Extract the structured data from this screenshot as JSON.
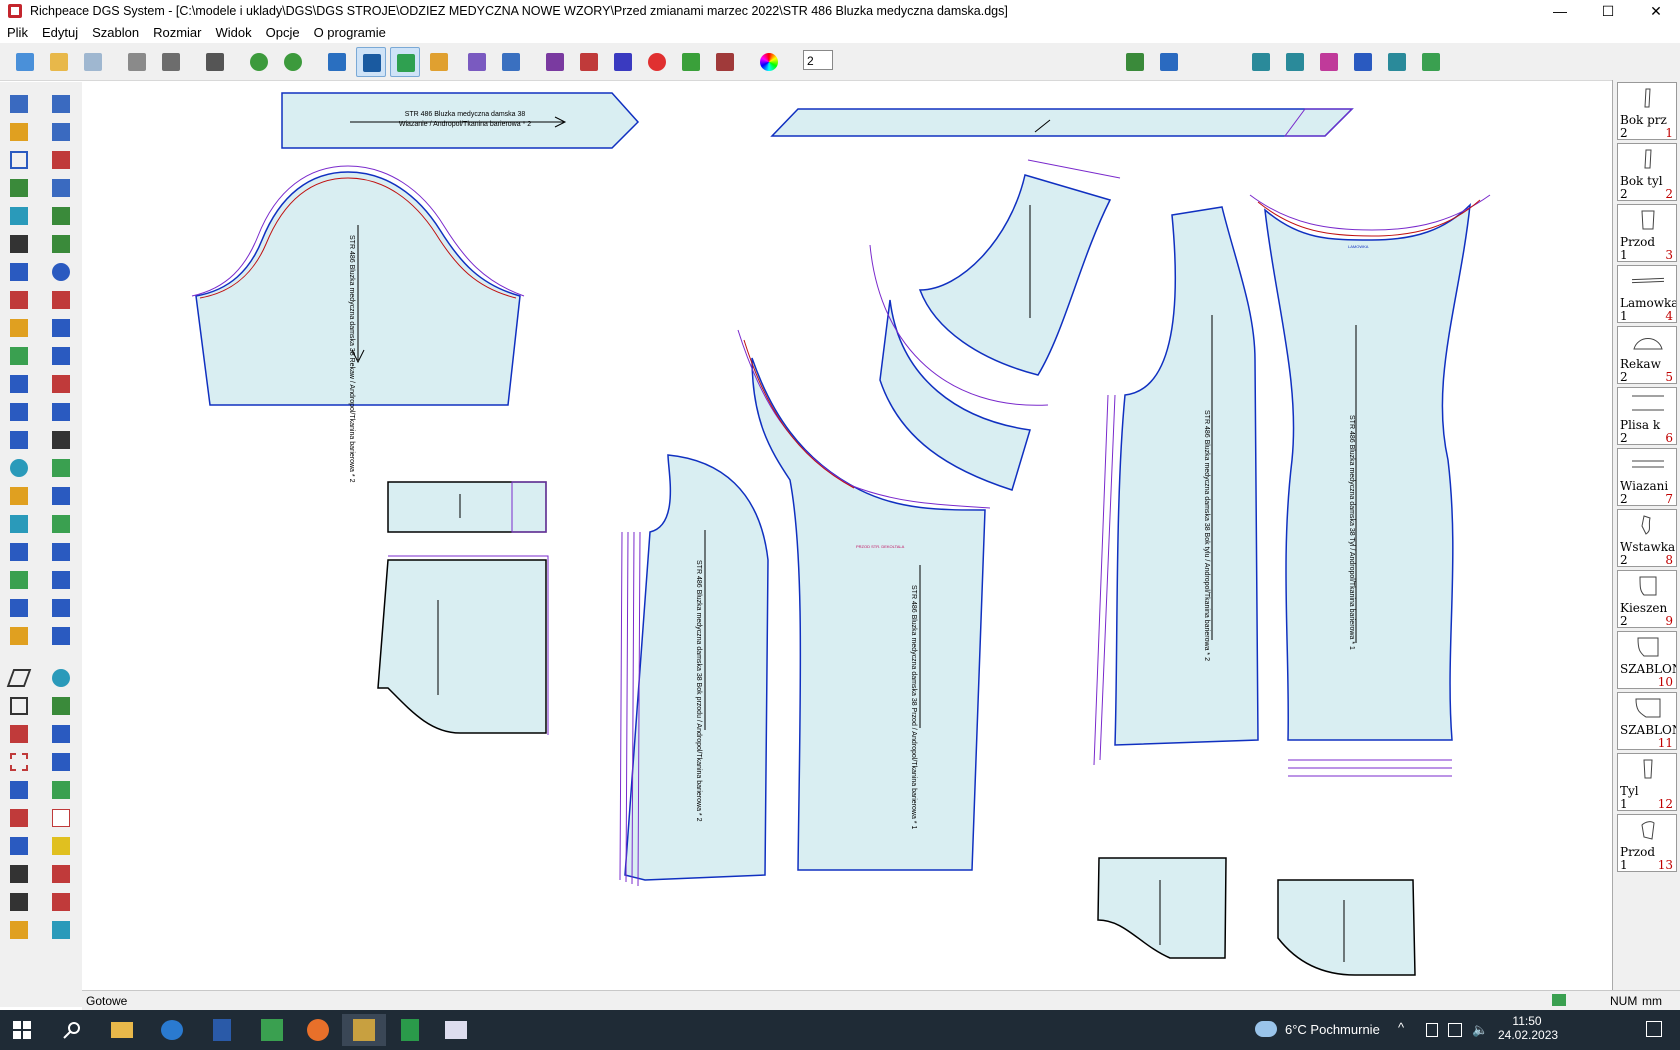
{
  "window": {
    "title": "Richpeace DGS System - [C:\\modele i uklady\\DGS\\DGS STROJE\\ODZIEZ MEDYCZNA NOWE WZORY\\Przed zmianami marzec 2022\\STR 486 Bluzka medyczna damska.dgs]",
    "minimize": "—",
    "maximize": "☐",
    "close": "✕"
  },
  "menu": [
    "Plik",
    "Edytuj",
    "Szablon",
    "Rozmiar",
    "Widok",
    "Opcje",
    "O programie"
  ],
  "toolbar": {
    "line_width_value": "2",
    "color_value": "#000000",
    "line_style": "solid"
  },
  "pieces": [
    {
      "name": "Bok prz",
      "qty": "2",
      "num": "1"
    },
    {
      "name": "Bok tyl",
      "qty": "2",
      "num": "2"
    },
    {
      "name": "Przod",
      "qty": "1",
      "num": "3"
    },
    {
      "name": "Lamowka",
      "qty": "1",
      "num": "4"
    },
    {
      "name": "Rekaw",
      "qty": "2",
      "num": "5"
    },
    {
      "name": "Plisa k",
      "qty": "2",
      "num": "6"
    },
    {
      "name": "Wiazani",
      "qty": "2",
      "num": "7"
    },
    {
      "name": "Wstawka",
      "qty": "2",
      "num": "8"
    },
    {
      "name": "Kieszen",
      "qty": "2",
      "num": "9"
    },
    {
      "name": "SZABLON",
      "qty": "",
      "num": "10"
    },
    {
      "name": "SZABLON",
      "qty": "",
      "num": "11"
    },
    {
      "name": "Tyl",
      "qty": "1",
      "num": "12"
    },
    {
      "name": "Przod",
      "qty": "1",
      "num": "13"
    }
  ],
  "canvas_labels": {
    "wiazanie_line1": "STR 486 Bluzka medyczna damska 38",
    "wiazanie_line2": "Wiazanie / Andropol/Tkanina barierowa * 2",
    "rekaw": "STR 486 Bluzka medyczna damska 38  Rekaw / Andropol/Tkanina barierowa * 2",
    "bok_przod": "STR 486 Bluzka medyczna damska 38  Bok przodu / Andropol/Tkanina barierowa * 2",
    "przod": "STR 486 Bluzka medyczna damska 38  Przod / Andropol/Tkanina barierowa * 1",
    "bok_tyl": "STR 486 Bluzka medyczna damska 38  Bok tylu / Andropol/Tkanina barierowa * 2",
    "tyl": "STR 486 Bluzka medyczna damska 38  Tyl / Andropol/Tkanina barierowa * 1",
    "lamowka_mark": "LAMOWKA",
    "przod_mark": "PRZOD STR. DEKOLTALA"
  },
  "status": {
    "text": "Gotowe",
    "num": "NUM",
    "unit": "mm"
  },
  "taskbar": {
    "weather": "6°C  Pochmurnie",
    "time": "11:50",
    "date": "24.02.2023"
  }
}
